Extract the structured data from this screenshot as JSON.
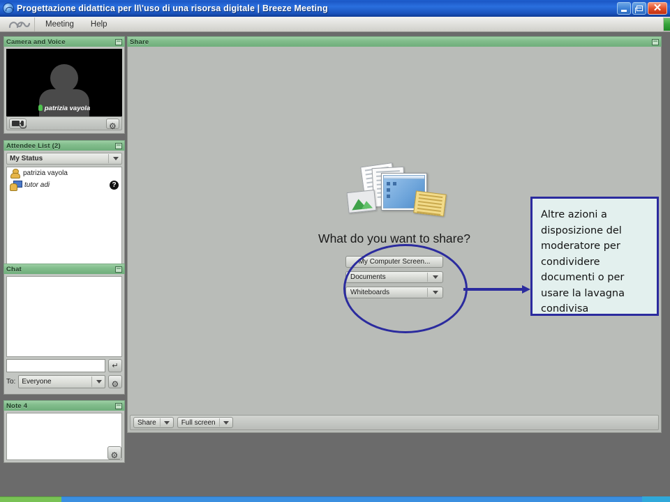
{
  "window": {
    "title": "Progettazione didattica per lI\\'uso di una risorsa digitale | Breeze Meeting",
    "app_icon": "breeze-logo-icon",
    "controls": {
      "minimize": "minimize-icon",
      "maximize": "maximize-icon",
      "close": "close-icon"
    }
  },
  "menubar": {
    "logo": "breeze-logo-icon",
    "items": [
      {
        "label": "Meeting"
      },
      {
        "label": "Help"
      }
    ],
    "connection_indicator_color": "#36a23a"
  },
  "pods": {
    "camera": {
      "title": "Camera and Voice",
      "speaker_name": "patrizia vayola",
      "mic_state_color": "#4ec24e",
      "buttons": {
        "camera_mic": "camera-mic-icon",
        "settings": "gear-icon"
      }
    },
    "attendee": {
      "title": "Attendee List (2)",
      "status_label": "My Status",
      "members": [
        {
          "name": "patrizia vayola",
          "role_icon": "host-icon",
          "status": ""
        },
        {
          "name": "tutor adi",
          "role_icon": "presenter-icon",
          "status": "?"
        }
      ]
    },
    "chat": {
      "title": "Chat",
      "messages": [],
      "input_value": "",
      "input_placeholder": "",
      "to_label": "To:",
      "to_value": "Everyone",
      "send_icon": "enter-arrow-icon",
      "settings_icon": "gear-icon"
    },
    "note": {
      "title": "Note 4",
      "content": "",
      "settings_icon": "gear-icon"
    },
    "share": {
      "title": "Share",
      "question": "What do you want to share?",
      "options": [
        {
          "label": "My Computer Screen...",
          "has_dropdown": false
        },
        {
          "label": "Documents",
          "has_dropdown": true
        },
        {
          "label": "Whiteboards",
          "has_dropdown": true
        }
      ],
      "toolbar": [
        {
          "label": "Share",
          "has_dropdown": true
        },
        {
          "label": "Full screen",
          "has_dropdown": true
        }
      ]
    }
  },
  "annotation": {
    "text": "Altre azioni a disposizione del moderatore per condividere documenti o per usare la lavagna condivisa",
    "accent_color": "#2b2b9e",
    "box_fill": "#e3f0ee"
  },
  "status_strips": {
    "green": "#79c255",
    "blue": "#3b8fe0",
    "cyan": "#2fa8da"
  }
}
